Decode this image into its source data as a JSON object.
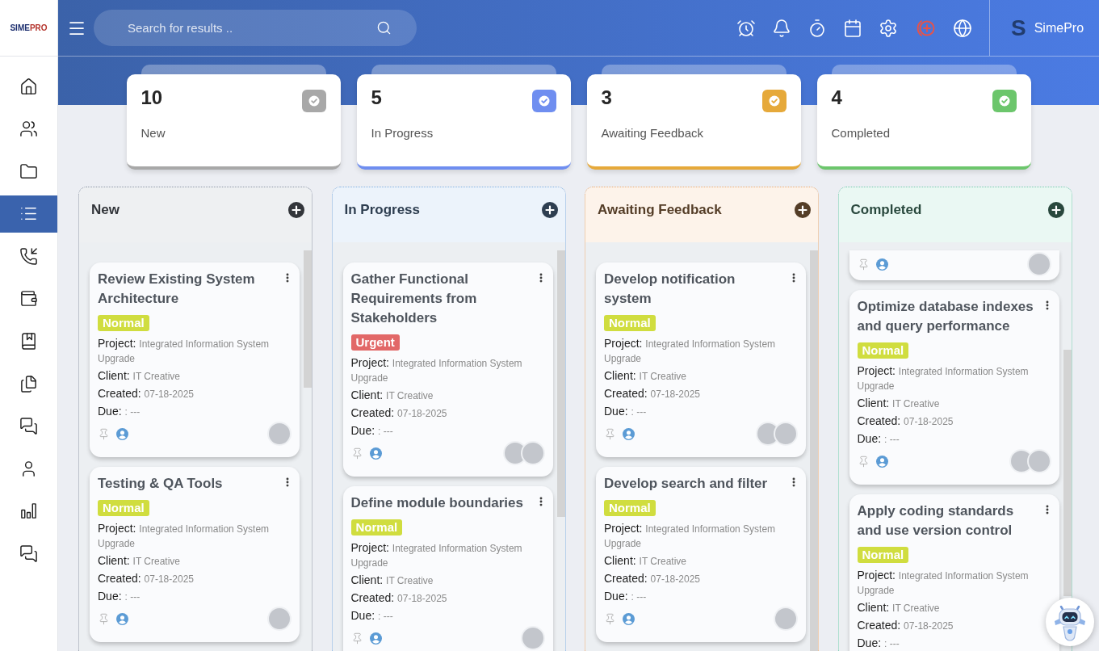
{
  "brand": {
    "logo": [
      "SIME",
      "PRO"
    ],
    "mark": "S",
    "name": "SimePro"
  },
  "search": {
    "placeholder": "Search for results .."
  },
  "sidebar": {
    "items": [
      {
        "selected": false
      },
      {
        "selected": false
      },
      {
        "selected": false
      },
      {
        "selected": true
      },
      {
        "selected": false
      },
      {
        "selected": false
      },
      {
        "selected": false
      },
      {
        "selected": false
      },
      {
        "selected": false
      },
      {
        "selected": false
      },
      {
        "selected": false
      },
      {
        "selected": false
      }
    ]
  },
  "stats": [
    {
      "count": "10",
      "label": "New",
      "color": "#a8a8a8"
    },
    {
      "count": "5",
      "label": "In Progress",
      "color": "#6f8ef0"
    },
    {
      "count": "3",
      "label": "Awaiting Feedback",
      "color": "#e6a93a"
    },
    {
      "count": "4",
      "label": "Completed",
      "color": "#6cc66c"
    }
  ],
  "columns": [
    {
      "title": "New",
      "color": "#8f98a6",
      "cards": [
        {
          "kind": "task",
          "title": "Review Existing System Architecture",
          "priority": {
            "label": "Normal",
            "color": "#d0dd3f"
          },
          "fields": [
            {
              "label": "Project:",
              "value": "Integrated Information System Upgrade"
            },
            {
              "label": "Client:",
              "value": "IT Creative"
            },
            {
              "label": "Created:",
              "value": "07-18-2025"
            },
            {
              "label": "Due:",
              "value": ": ---"
            }
          ],
          "assignees": [
            {
              "kind": "photo"
            }
          ]
        },
        {
          "kind": "task",
          "title": "Testing & QA Tools",
          "priority": {
            "label": "Normal",
            "color": "#d0dd3f"
          },
          "fields": [
            {
              "label": "Project:",
              "value": "Integrated Information System Upgrade"
            },
            {
              "label": "Client:",
              "value": "IT Creative"
            },
            {
              "label": "Created:",
              "value": "07-18-2025"
            },
            {
              "label": "Due:",
              "value": ": ---"
            }
          ],
          "assignees": [
            {
              "kind": "photo"
            }
          ]
        }
      ]
    },
    {
      "title": "In Progress",
      "color": "#82b2e4",
      "cards": [
        {
          "kind": "task",
          "title": "Gather Functional Requirements from Stakeholders",
          "priority": {
            "label": "Urgent",
            "color": "#e26868"
          },
          "fields": [
            {
              "label": "Project:",
              "value": "Integrated Information System Upgrade"
            },
            {
              "label": "Client:",
              "value": "IT Creative"
            },
            {
              "label": "Created:",
              "value": "07-18-2025"
            },
            {
              "label": "Due:",
              "value": ": ---"
            }
          ],
          "assignees": [
            {
              "kind": "photo"
            },
            {
              "kind": "photo"
            }
          ]
        },
        {
          "kind": "task",
          "title": "Define module boundaries",
          "priority": {
            "label": "Normal",
            "color": "#d0dd3f"
          },
          "fields": [
            {
              "label": "Project:",
              "value": "Integrated Information System Upgrade"
            },
            {
              "label": "Client:",
              "value": "IT Creative"
            },
            {
              "label": "Created:",
              "value": "07-18-2025"
            },
            {
              "label": "Due:",
              "value": ": ---"
            }
          ],
          "assignees": [
            {
              "kind": "photo"
            }
          ]
        }
      ]
    },
    {
      "title": "Awaiting Feedback",
      "color": "#f0ad70",
      "cards": [
        {
          "kind": "task",
          "title": "Develop notification system",
          "priority": {
            "label": "Normal",
            "color": "#d0dd3f"
          },
          "fields": [
            {
              "label": "Project:",
              "value": "Integrated Information System Upgrade"
            },
            {
              "label": "Client:",
              "value": "IT Creative"
            },
            {
              "label": "Created:",
              "value": "07-18-2025"
            },
            {
              "label": "Due:",
              "value": ": ---"
            }
          ],
          "assignees": [
            {
              "kind": "photo"
            },
            {
              "kind": "photo"
            }
          ]
        },
        {
          "kind": "task",
          "title": "Develop search and filter",
          "priority": {
            "label": "Normal",
            "color": "#d0dd3f"
          },
          "fields": [
            {
              "label": "Project:",
              "value": "Integrated Information System Upgrade"
            },
            {
              "label": "Client:",
              "value": "IT Creative"
            },
            {
              "label": "Created:",
              "value": "07-18-2025"
            },
            {
              "label": "Due:",
              "value": ": ---"
            }
          ],
          "assignees": [
            {
              "kind": "photo"
            }
          ]
        }
      ]
    },
    {
      "title": "Completed",
      "color": "#74cfae",
      "cards": [
        {
          "kind": "footer",
          "assignees": [
            {
              "kind": "photo"
            }
          ]
        },
        {
          "kind": "task",
          "title": "Optimize database indexes and query performance",
          "priority": {
            "label": "Normal",
            "color": "#d0dd3f"
          },
          "fields": [
            {
              "label": "Project:",
              "value": "Integrated Information System Upgrade"
            },
            {
              "label": "Client:",
              "value": "IT Creative"
            },
            {
              "label": "Created:",
              "value": "07-18-2025"
            },
            {
              "label": "Due:",
              "value": ": ---"
            }
          ],
          "assignees": [
            {
              "kind": "photo"
            },
            {
              "kind": "photo"
            }
          ]
        },
        {
          "kind": "task",
          "title": "Apply coding standards and use version control",
          "priority": {
            "label": "Normal",
            "color": "#d0dd3f"
          },
          "fields": [
            {
              "label": "Project:",
              "value": "Integrated Information System Upgrade"
            },
            {
              "label": "Client:",
              "value": "IT Creative"
            },
            {
              "label": "Created:",
              "value": "07-18-2025"
            },
            {
              "label": "Due:",
              "value": ": ---"
            }
          ]
        }
      ]
    }
  ]
}
